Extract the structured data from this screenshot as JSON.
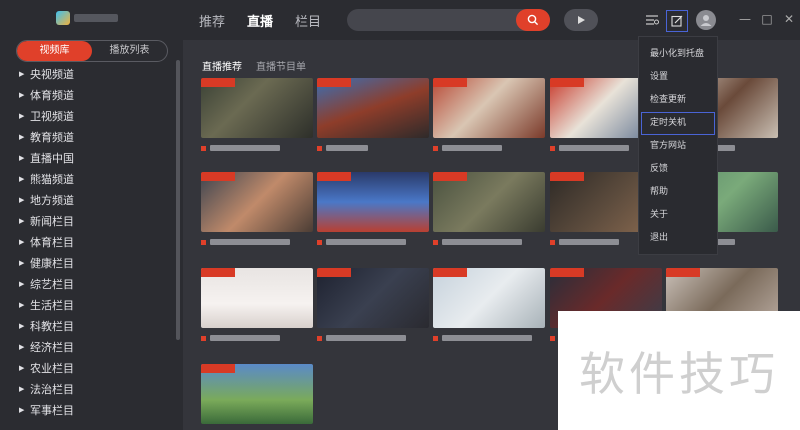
{
  "sidebar": {
    "tabs": [
      {
        "label": "视频库",
        "active": true
      },
      {
        "label": "播放列表",
        "active": false
      }
    ],
    "items": [
      {
        "label": "央视频道"
      },
      {
        "label": "体育频道"
      },
      {
        "label": "卫视频道"
      },
      {
        "label": "教育频道"
      },
      {
        "label": "直播中国"
      },
      {
        "label": "熊猫频道"
      },
      {
        "label": "地方频道"
      },
      {
        "label": "新闻栏目"
      },
      {
        "label": "体育栏目"
      },
      {
        "label": "健康栏目"
      },
      {
        "label": "综艺栏目"
      },
      {
        "label": "生活栏目"
      },
      {
        "label": "科教栏目"
      },
      {
        "label": "经济栏目"
      },
      {
        "label": "农业栏目"
      },
      {
        "label": "法治栏目"
      },
      {
        "label": "军事栏目"
      }
    ]
  },
  "topbar": {
    "nav": [
      {
        "label": "推荐",
        "active": false
      },
      {
        "label": "直播",
        "active": true
      },
      {
        "label": "栏目",
        "active": false
      }
    ],
    "search_placeholder": "",
    "icons": [
      "search-icon",
      "play-icon",
      "list-icon",
      "edit-icon",
      "avatar",
      "minimize-icon",
      "maximize-icon",
      "close-icon"
    ]
  },
  "subtabs": [
    {
      "label": "直播推荐",
      "active": true
    },
    {
      "label": "直播节目单",
      "active": false
    }
  ],
  "menu": {
    "items": [
      {
        "label": "最小化到托盘"
      },
      {
        "label": "设置"
      },
      {
        "label": "检查更新"
      },
      {
        "label": "定时关机",
        "highlighted": true
      },
      {
        "label": "官方网站"
      },
      {
        "label": "反馈"
      },
      {
        "label": "帮助"
      },
      {
        "label": "关于"
      },
      {
        "label": "退出"
      }
    ]
  },
  "watermark": {
    "text": "软件技巧"
  },
  "colors": {
    "accent": "#e0402a",
    "bg": "#34353b",
    "sidebar": "#2b2c31",
    "highlight": "#4a64d6"
  }
}
